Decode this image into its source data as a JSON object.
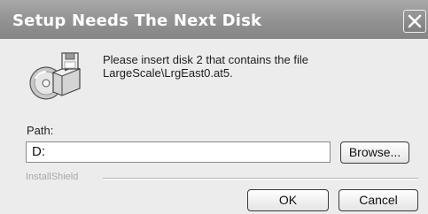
{
  "window": {
    "title": "Setup Needs The Next Disk"
  },
  "message": {
    "line1": "Please insert disk 2 that contains the file",
    "line2": "LargeScale\\LrgEast0.at5."
  },
  "path": {
    "label": "Path:",
    "value": "D:"
  },
  "buttons": {
    "browse": "Browse...",
    "ok": "OK",
    "cancel": "Cancel"
  },
  "footer": {
    "brand": "InstallShield"
  },
  "icons": {
    "close": "close-icon",
    "disk": "disk-drive-icon"
  }
}
